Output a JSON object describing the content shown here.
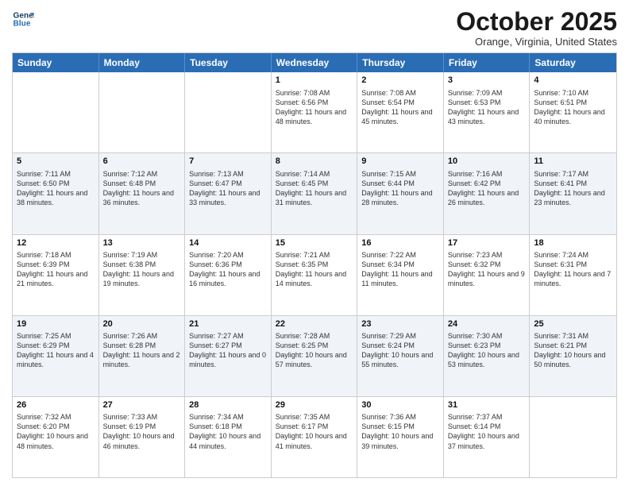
{
  "header": {
    "logo_line1": "General",
    "logo_line2": "Blue",
    "month": "October 2025",
    "location": "Orange, Virginia, United States"
  },
  "days_of_week": [
    "Sunday",
    "Monday",
    "Tuesday",
    "Wednesday",
    "Thursday",
    "Friday",
    "Saturday"
  ],
  "rows": [
    [
      {
        "day": "",
        "info": ""
      },
      {
        "day": "",
        "info": ""
      },
      {
        "day": "",
        "info": ""
      },
      {
        "day": "1",
        "info": "Sunrise: 7:08 AM\nSunset: 6:56 PM\nDaylight: 11 hours and 48 minutes."
      },
      {
        "day": "2",
        "info": "Sunrise: 7:08 AM\nSunset: 6:54 PM\nDaylight: 11 hours and 45 minutes."
      },
      {
        "day": "3",
        "info": "Sunrise: 7:09 AM\nSunset: 6:53 PM\nDaylight: 11 hours and 43 minutes."
      },
      {
        "day": "4",
        "info": "Sunrise: 7:10 AM\nSunset: 6:51 PM\nDaylight: 11 hours and 40 minutes."
      }
    ],
    [
      {
        "day": "5",
        "info": "Sunrise: 7:11 AM\nSunset: 6:50 PM\nDaylight: 11 hours and 38 minutes."
      },
      {
        "day": "6",
        "info": "Sunrise: 7:12 AM\nSunset: 6:48 PM\nDaylight: 11 hours and 36 minutes."
      },
      {
        "day": "7",
        "info": "Sunrise: 7:13 AM\nSunset: 6:47 PM\nDaylight: 11 hours and 33 minutes."
      },
      {
        "day": "8",
        "info": "Sunrise: 7:14 AM\nSunset: 6:45 PM\nDaylight: 11 hours and 31 minutes."
      },
      {
        "day": "9",
        "info": "Sunrise: 7:15 AM\nSunset: 6:44 PM\nDaylight: 11 hours and 28 minutes."
      },
      {
        "day": "10",
        "info": "Sunrise: 7:16 AM\nSunset: 6:42 PM\nDaylight: 11 hours and 26 minutes."
      },
      {
        "day": "11",
        "info": "Sunrise: 7:17 AM\nSunset: 6:41 PM\nDaylight: 11 hours and 23 minutes."
      }
    ],
    [
      {
        "day": "12",
        "info": "Sunrise: 7:18 AM\nSunset: 6:39 PM\nDaylight: 11 hours and 21 minutes."
      },
      {
        "day": "13",
        "info": "Sunrise: 7:19 AM\nSunset: 6:38 PM\nDaylight: 11 hours and 19 minutes."
      },
      {
        "day": "14",
        "info": "Sunrise: 7:20 AM\nSunset: 6:36 PM\nDaylight: 11 hours and 16 minutes."
      },
      {
        "day": "15",
        "info": "Sunrise: 7:21 AM\nSunset: 6:35 PM\nDaylight: 11 hours and 14 minutes."
      },
      {
        "day": "16",
        "info": "Sunrise: 7:22 AM\nSunset: 6:34 PM\nDaylight: 11 hours and 11 minutes."
      },
      {
        "day": "17",
        "info": "Sunrise: 7:23 AM\nSunset: 6:32 PM\nDaylight: 11 hours and 9 minutes."
      },
      {
        "day": "18",
        "info": "Sunrise: 7:24 AM\nSunset: 6:31 PM\nDaylight: 11 hours and 7 minutes."
      }
    ],
    [
      {
        "day": "19",
        "info": "Sunrise: 7:25 AM\nSunset: 6:29 PM\nDaylight: 11 hours and 4 minutes."
      },
      {
        "day": "20",
        "info": "Sunrise: 7:26 AM\nSunset: 6:28 PM\nDaylight: 11 hours and 2 minutes."
      },
      {
        "day": "21",
        "info": "Sunrise: 7:27 AM\nSunset: 6:27 PM\nDaylight: 11 hours and 0 minutes."
      },
      {
        "day": "22",
        "info": "Sunrise: 7:28 AM\nSunset: 6:25 PM\nDaylight: 10 hours and 57 minutes."
      },
      {
        "day": "23",
        "info": "Sunrise: 7:29 AM\nSunset: 6:24 PM\nDaylight: 10 hours and 55 minutes."
      },
      {
        "day": "24",
        "info": "Sunrise: 7:30 AM\nSunset: 6:23 PM\nDaylight: 10 hours and 53 minutes."
      },
      {
        "day": "25",
        "info": "Sunrise: 7:31 AM\nSunset: 6:21 PM\nDaylight: 10 hours and 50 minutes."
      }
    ],
    [
      {
        "day": "26",
        "info": "Sunrise: 7:32 AM\nSunset: 6:20 PM\nDaylight: 10 hours and 48 minutes."
      },
      {
        "day": "27",
        "info": "Sunrise: 7:33 AM\nSunset: 6:19 PM\nDaylight: 10 hours and 46 minutes."
      },
      {
        "day": "28",
        "info": "Sunrise: 7:34 AM\nSunset: 6:18 PM\nDaylight: 10 hours and 44 minutes."
      },
      {
        "day": "29",
        "info": "Sunrise: 7:35 AM\nSunset: 6:17 PM\nDaylight: 10 hours and 41 minutes."
      },
      {
        "day": "30",
        "info": "Sunrise: 7:36 AM\nSunset: 6:15 PM\nDaylight: 10 hours and 39 minutes."
      },
      {
        "day": "31",
        "info": "Sunrise: 7:37 AM\nSunset: 6:14 PM\nDaylight: 10 hours and 37 minutes."
      },
      {
        "day": "",
        "info": ""
      }
    ]
  ]
}
